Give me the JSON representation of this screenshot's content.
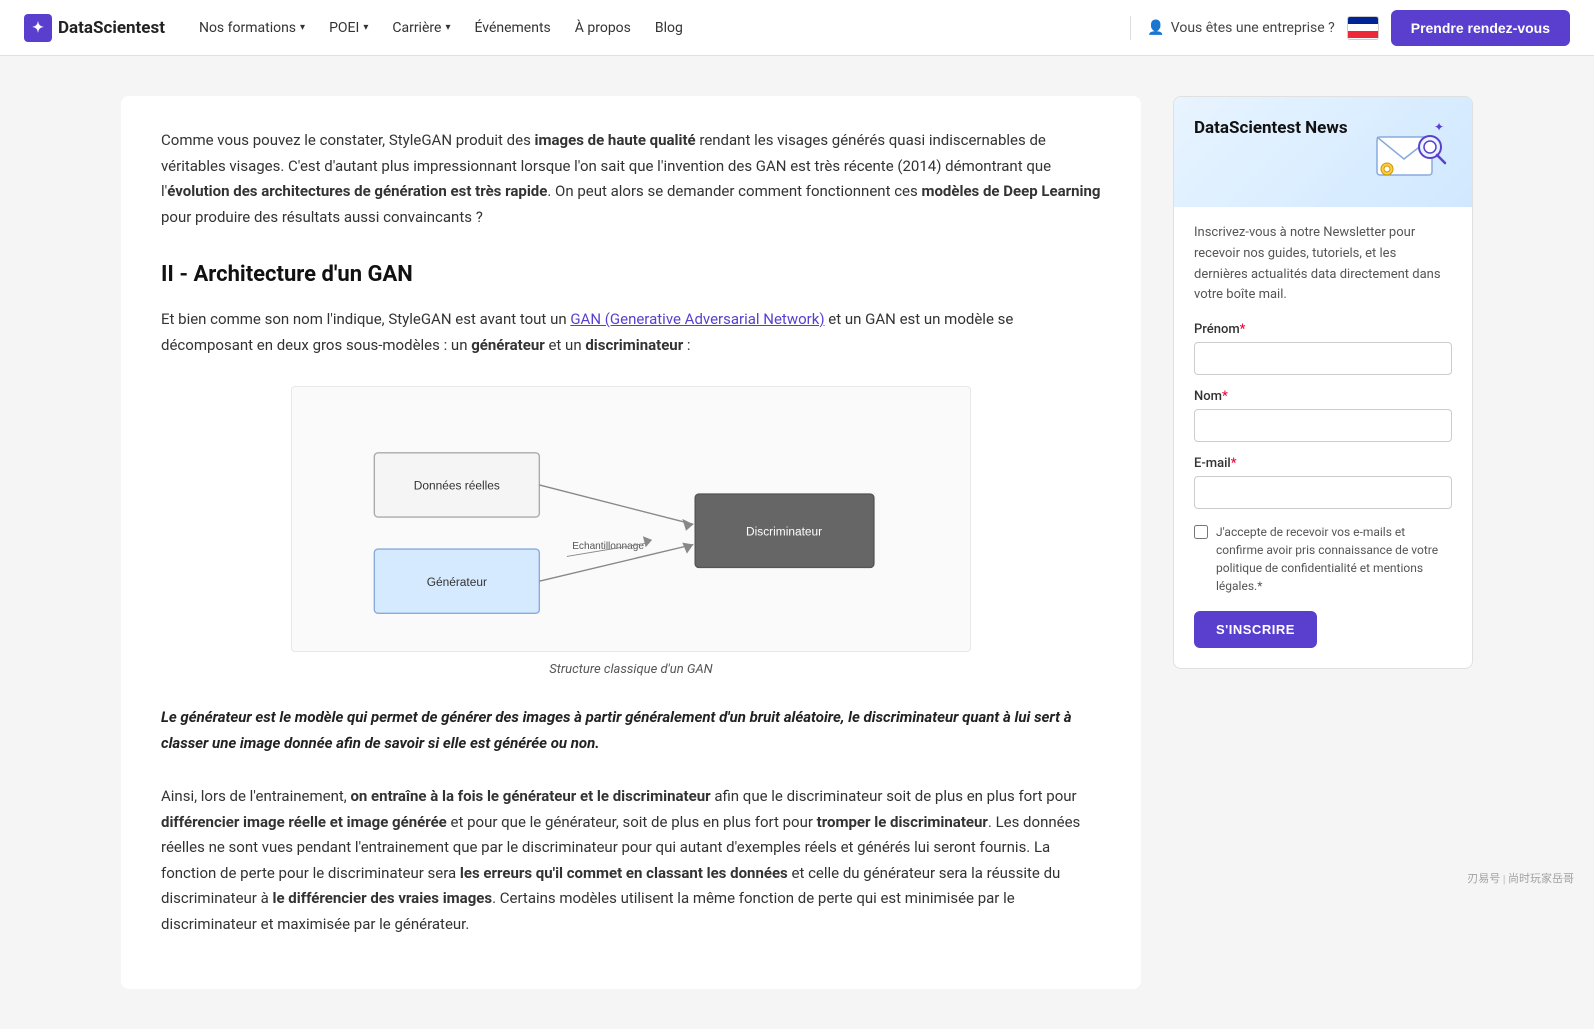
{
  "navbar": {
    "logo_text": "DataScientest",
    "nav_items": [
      {
        "label": "Nos formations",
        "has_dropdown": true
      },
      {
        "label": "POEI",
        "has_dropdown": true
      },
      {
        "label": "Carrière",
        "has_dropdown": true
      },
      {
        "label": "Événements",
        "has_dropdown": false
      },
      {
        "label": "À propos",
        "has_dropdown": false
      },
      {
        "label": "Blog",
        "has_dropdown": false
      }
    ],
    "enterprise_label": "Vous êtes une entreprise ?",
    "cta_label": "Prendre rendez-vous"
  },
  "intro": {
    "text_start": "Comme vous pouvez le constater, StyleGAN produit des ",
    "bold1": "images de haute qualité",
    "text_middle1": " rendant les visages générés quasi indiscernables de véritables visages. C'est d'autant plus impressionnant lorsque l'on sait que l'invention des GAN est très récente (2014) démontrant que l'",
    "bold2": "évolution des architectures de génération est très rapide",
    "text_middle2": ". On peut alors se demander comment fonctionnent ces ",
    "bold3": "modèles de Deep Learning",
    "text_end": " pour produire des résultats aussi convaincants ?"
  },
  "section": {
    "heading": "II - Architecture d'un GAN",
    "intro_start": "Et bien comme son nom l'indique, StyleGAN est avant tout un ",
    "link_text": "GAN (Generative Adversarial Network)",
    "intro_middle": " et un GAN est un modèle se décomposant en deux gros sous-modèles : un ",
    "bold_generateur": "générateur",
    "intro_and": " et un ",
    "bold_discriminateur": "discriminateur",
    "intro_end": " :"
  },
  "diagram": {
    "caption": "Structure classique d'un GAN",
    "node_donnees": "Données réelles",
    "node_generateur": "Générateur",
    "node_discriminateur": "Discriminateur",
    "edge_label": "Echantillonnage"
  },
  "blockquote": "Le générateur est le modèle qui permet de générer des images à partir généralement d'un bruit aléatoire, le discriminateur quant à lui sert à classer une image donnée afin de savoir si elle est générée ou non.",
  "body_paragraphs": [
    {
      "id": "p1",
      "segments": [
        {
          "text": "Ainsi, lors de l'entrainement, ",
          "bold": false
        },
        {
          "text": "on entraîne à la fois le générateur et le discriminateur",
          "bold": true
        },
        {
          "text": " afin que le discriminateur soit de plus en plus fort pour ",
          "bold": false
        },
        {
          "text": "différencier image réelle et image générée",
          "bold": true
        },
        {
          "text": " et pour que le générateur, soit de plus en plus fort pour ",
          "bold": false
        },
        {
          "text": "tromper le discriminateur",
          "bold": true
        },
        {
          "text": ". Les données réelles ne sont vues pendant l'entrainement que par le discriminateur pour qui autant d'exemples réels et générés lui seront fournis. La fonction de perte pour le discriminateur sera ",
          "bold": false
        },
        {
          "text": "les erreurs qu'il commet en classant les données",
          "bold": true
        },
        {
          "text": " et celle du générateur sera la réussite du discriminateur à ",
          "bold": false
        },
        {
          "text": "le différencier des vraies images",
          "bold": true
        },
        {
          "text": ". Certains modèles utilisent la même fonction de perte qui est minimisée par le discriminateur et maximisée par le générateur.",
          "bold": false
        }
      ]
    }
  ],
  "sidebar": {
    "title": "DataScientest News",
    "description": "Inscrivez-vous à notre Newsletter pour recevoir nos guides, tutoriels, et les dernières actualités data directement dans votre boîte mail.",
    "fields": {
      "prenom_label": "Prénom",
      "prenom_required": "*",
      "nom_label": "Nom",
      "nom_required": "*",
      "email_label": "E-mail",
      "email_required": "*"
    },
    "checkbox_text": "J'accepte de recevoir vos e-mails et confirme avoir pris connaissance de votre politique de confidentialité et mentions légales.",
    "checkbox_required": "*",
    "subscribe_btn": "S'INSCRIRE"
  },
  "watermark": "刃易号 | 尚时玩家岳哥"
}
